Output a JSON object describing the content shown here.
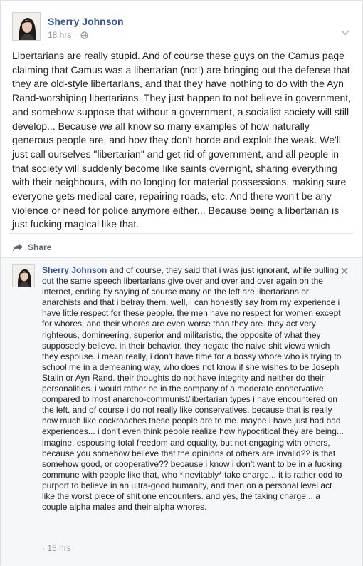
{
  "post": {
    "author": "Sherry Johnson",
    "timestamp": "18 hrs",
    "separator": "·",
    "privacy_icon": "globe-icon",
    "text": "Libertarians are really stupid. And of course these guys on the Camus page claiming that Camus was a libertarian (not!) are bringing out the defense that they are old-style libertarians, and that they have nothing to do with the Ayn Rand-worshiping libertarians. They just happen to not believe in government, and somehow suppose that without a government, a socialist society will still develop... Because we all know so many examples of how naturally generous people are, and how they don't horde and exploit the weak. We'll just call ourselves \"libertarian\" and get rid of government, and all people in that society will suddenly become like saints overnight, sharing everything with their neighbours, with no longing for material possessions, making sure everyone gets medical care, repairing roads, etc. And there won't be any violence or need for police anymore either... Because being a libertarian is just fucking magical like that.",
    "share_label": "Share"
  },
  "comment": {
    "author": "Sherry Johnson",
    "text": "and of course, they said that i was just ignorant, while pulling out the same speech libertarians give over and over and over again on the internet, ending by saying of course many on the left are libertarians or anarchists and that i betray them. well, i can honestly say from my experience i have little respect for these people. the men have no respect for women except for whores, and their whores are even worse than they are. they act very righteous, domineering, superior and militaristic, the opposite of what they supposedly believe. in their behavior, they negate the naive shit views which they espouse. i mean really, i don't have time for a bossy whore who is trying to school me in a demeaning way, who does not know if she wishes to be Joseph Stalin or Ayn Rand. their thoughts do not have integrity and neither do their personalities. i would rather be in the company of a moderate conservative compared to most anarcho-communist/libertarian types i have encountered on the left. and of course i do not really like conservatives. because that is really how much like cockroaches these people are to me. maybe i have just had bad experiences... i don't even think people realize how hypocritical they are being... imagine, espousing total freedom and equality, but not engaging with others, because you somehow believe that the opinions of others are invalid?? is that somehow good, or cooperative?? because i know i don't want to be in a fucking commune with people like that, who *inevitably* take charge... it is rather odd to purport to believe in an ultra-good humanity, and then on a personal level act like the worst piece of shit one encounters. and yes, the taking charge... a couple alpha males and their alpha whores.",
    "separator": "·",
    "timestamp": "15 hrs"
  },
  "colors": {
    "link": "#365899",
    "text": "#1d2129",
    "meta": "#90949c",
    "comment_bg": "#f6f7f9"
  }
}
